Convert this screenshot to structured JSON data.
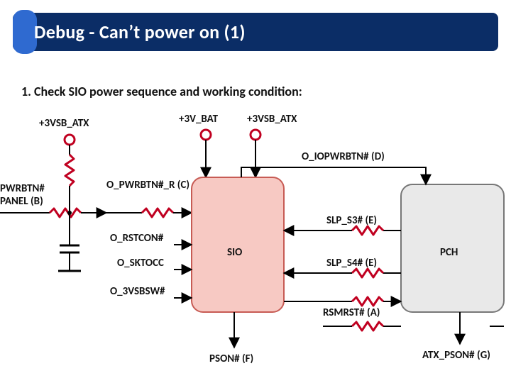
{
  "title": "Debug - Can’t power on (1)",
  "heading": "1. Check SIO power sequence and working condition:",
  "rails": {
    "vsb_atx_left": "+3VSB_ATX",
    "vbat": "+3V_BAT",
    "vsb_atx_right": "+3VSB_ATX"
  },
  "left_input": {
    "name": "PWRBTN#",
    "panel": "PANEL (B)"
  },
  "sio": {
    "label": "SIO",
    "signals": {
      "o_pwrbtn_r": "O_PWRBTN#_R (C)",
      "o_rstcon": "O_RSTCON#",
      "o_sktocc": "O_SKTOCC",
      "o_3vsbsw": "O_3VSBSW#",
      "o_iopwrbtn": "O_IOPWRBTN# (D)",
      "slp_s3": "SLP_S3# (E)",
      "slp_s4": "SLP_S4# (E)",
      "rsmrst": "RSMRST# (A)",
      "pson": "PSON# (F)"
    }
  },
  "pch": {
    "label": "PCH",
    "atx_pson": "ATX_PSON# (G)"
  }
}
